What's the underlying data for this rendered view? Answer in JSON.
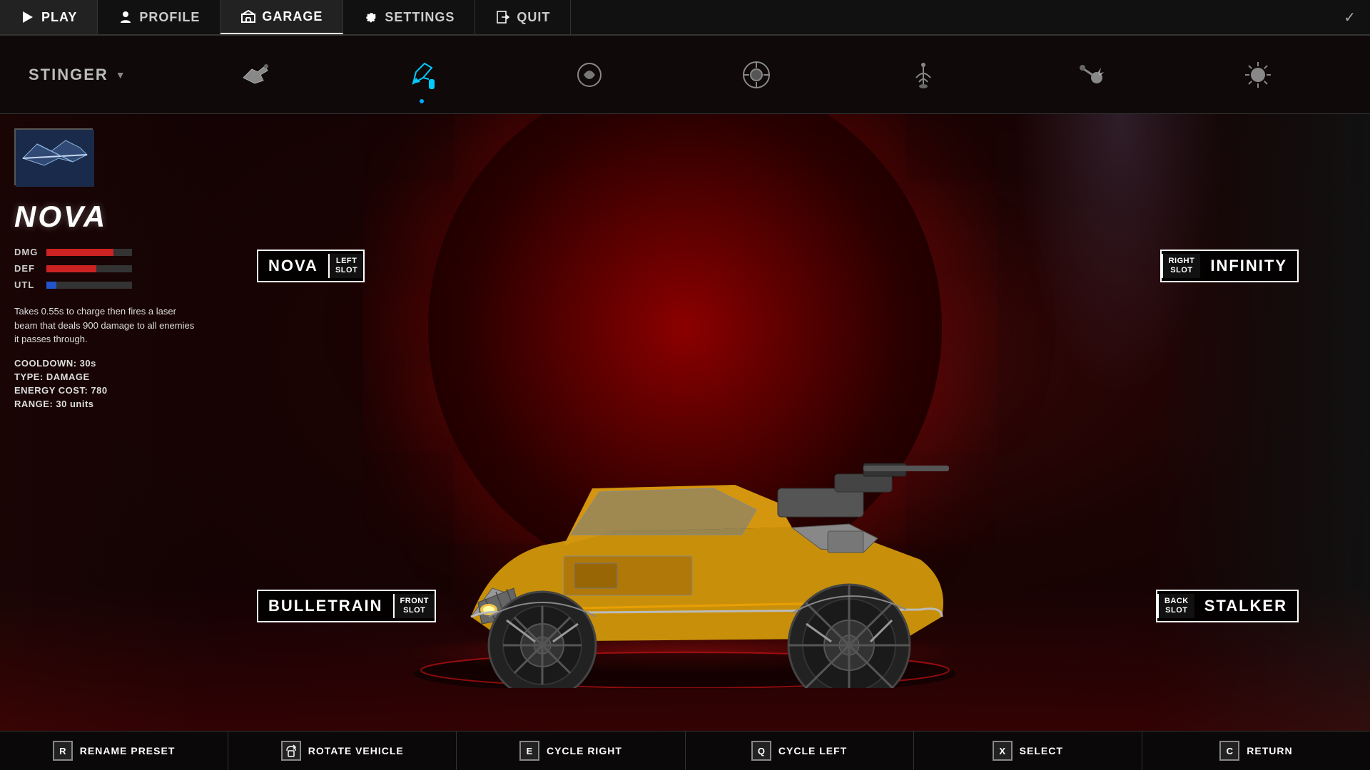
{
  "nav": {
    "items": [
      {
        "id": "play",
        "label": "PLAY",
        "icon": "play"
      },
      {
        "id": "profile",
        "label": "PROFILE",
        "icon": "person"
      },
      {
        "id": "garage",
        "label": "GARAGE",
        "icon": "garage",
        "active": true
      },
      {
        "id": "settings",
        "label": "SETTINGS",
        "icon": "gear"
      },
      {
        "id": "quit",
        "label": "QUIT",
        "icon": "door"
      }
    ],
    "checkmark": "✓"
  },
  "toolbar": {
    "preset": "STINGER",
    "icons": [
      {
        "id": "weapons",
        "name": "Weapons"
      },
      {
        "id": "paint",
        "name": "Paint",
        "selected": true
      },
      {
        "id": "decal",
        "name": "Decal"
      },
      {
        "id": "wheels",
        "name": "Wheels"
      },
      {
        "id": "antenna",
        "name": "Antenna"
      },
      {
        "id": "effect",
        "name": "Effect"
      },
      {
        "id": "boost",
        "name": "Boost"
      }
    ]
  },
  "weapon_info": {
    "title": "NOVA",
    "stats": {
      "dmg_label": "DMG",
      "def_label": "DEF",
      "utl_label": "UTL",
      "dmg_pct": 78,
      "def_pct": 58,
      "utl_pct": 12
    },
    "description": "Takes 0.55s to charge then fires a laser beam that deals 900 damage to all enemies it passes through.",
    "cooldown": "COOLDOWN: 30s",
    "type": "TYPE: DAMAGE",
    "energy_cost": "ENERGY COST: 780",
    "range": "RANGE: 30 units"
  },
  "slots": {
    "left": {
      "weapon": "NOVA",
      "slot_line1": "LEFT",
      "slot_line2": "SLOT"
    },
    "right": {
      "weapon": "INFINITY",
      "slot_line1": "RIGHT",
      "slot_line2": "SLOT"
    },
    "front": {
      "weapon": "BULLETRAIN",
      "slot_line1": "FRONT",
      "slot_line2": "SLOT"
    },
    "back": {
      "weapon": "STALKER",
      "slot_line1": "BACK",
      "slot_line2": "SLOT"
    }
  },
  "bottom_bar": {
    "actions": [
      {
        "key": "R",
        "label": "RENAME PRESET",
        "key_type": "letter"
      },
      {
        "key": "rotate",
        "label": "ROTATE VEHICLE",
        "key_type": "icon"
      },
      {
        "key": "E",
        "label": "CYCLE RIGHT",
        "key_type": "letter"
      },
      {
        "key": "Q",
        "label": "CYCLE LEFT",
        "key_type": "letter"
      },
      {
        "key": "X",
        "label": "SELECT",
        "key_type": "letter"
      },
      {
        "key": "C",
        "label": "RETURN",
        "key_type": "letter"
      }
    ]
  }
}
